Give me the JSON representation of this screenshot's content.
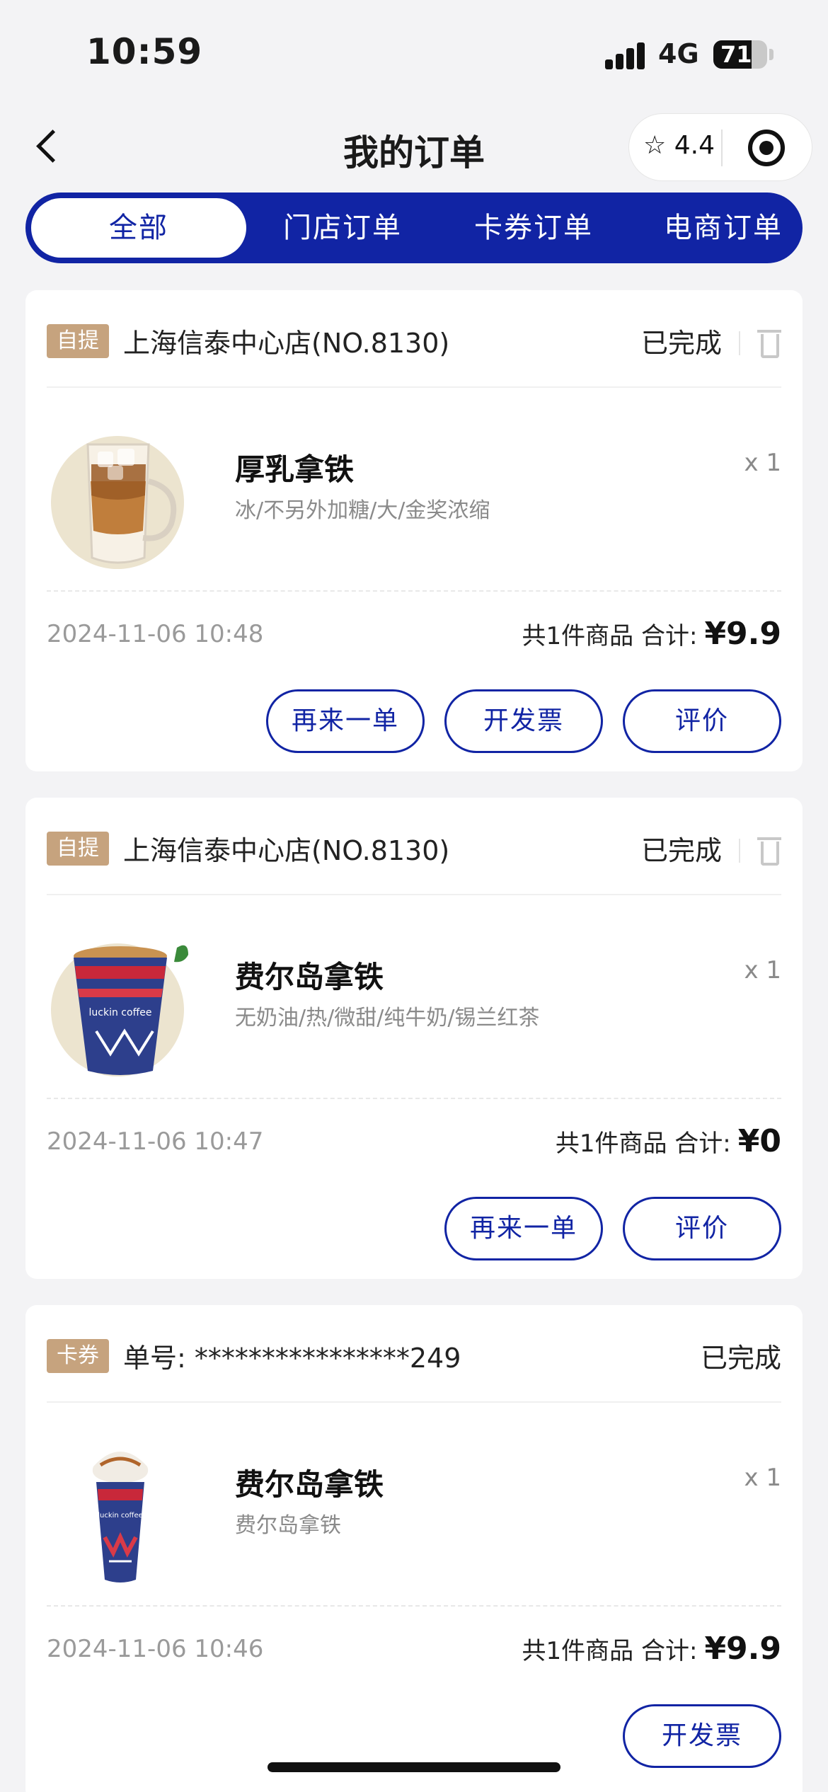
{
  "status_bar": {
    "time": "10:59",
    "network": "4G",
    "battery": "71",
    "battery_level": 0.71
  },
  "nav": {
    "title": "我的订单",
    "rating": "☆ 4.4"
  },
  "tabs": [
    {
      "label": "全部",
      "active": true
    },
    {
      "label": "门店订单",
      "active": false
    },
    {
      "label": "卡券订单",
      "active": false
    },
    {
      "label": "电商订单",
      "active": false
    }
  ],
  "orders": [
    {
      "tag": "自提",
      "store": "上海信泰中心店(NO.8130)",
      "status": "已完成",
      "product": {
        "name": "厚乳拿铁",
        "spec": "冰/不另外加糖/大/金奖浓缩",
        "qty": "x 1"
      },
      "time": "2024-11-06 10:48",
      "total_label": "共1件商品  合计:",
      "price": "¥9.9",
      "buttons": [
        "再来一单",
        "开发票",
        "评价"
      ]
    },
    {
      "tag": "自提",
      "store": "上海信泰中心店(NO.8130)",
      "status": "已完成",
      "product": {
        "name": "费尔岛拿铁",
        "spec": "无奶油/热/微甜/纯牛奶/锡兰红茶",
        "qty": "x 1"
      },
      "time": "2024-11-06 10:47",
      "total_label": "共1件商品  合计:",
      "price": "¥0",
      "buttons": [
        "再来一单",
        "评价"
      ]
    },
    {
      "tag": "卡券",
      "store": "单号: ****************249",
      "status": "已完成",
      "product": {
        "name": "费尔岛拿铁",
        "spec": "费尔岛拿铁",
        "qty": "x 1"
      },
      "time": "2024-11-06 10:46",
      "total_label": "共1件商品  合计:",
      "price": "¥9.9",
      "buttons": [
        "开发票"
      ]
    }
  ],
  "colors": {
    "brand": "#1124a4",
    "tag": "#c6a37e",
    "background": "#f3f3f5"
  },
  "icons": {
    "back": "chevron-left-icon",
    "rating": "star-icon",
    "close": "record-icon",
    "delete": "trash-icon"
  }
}
